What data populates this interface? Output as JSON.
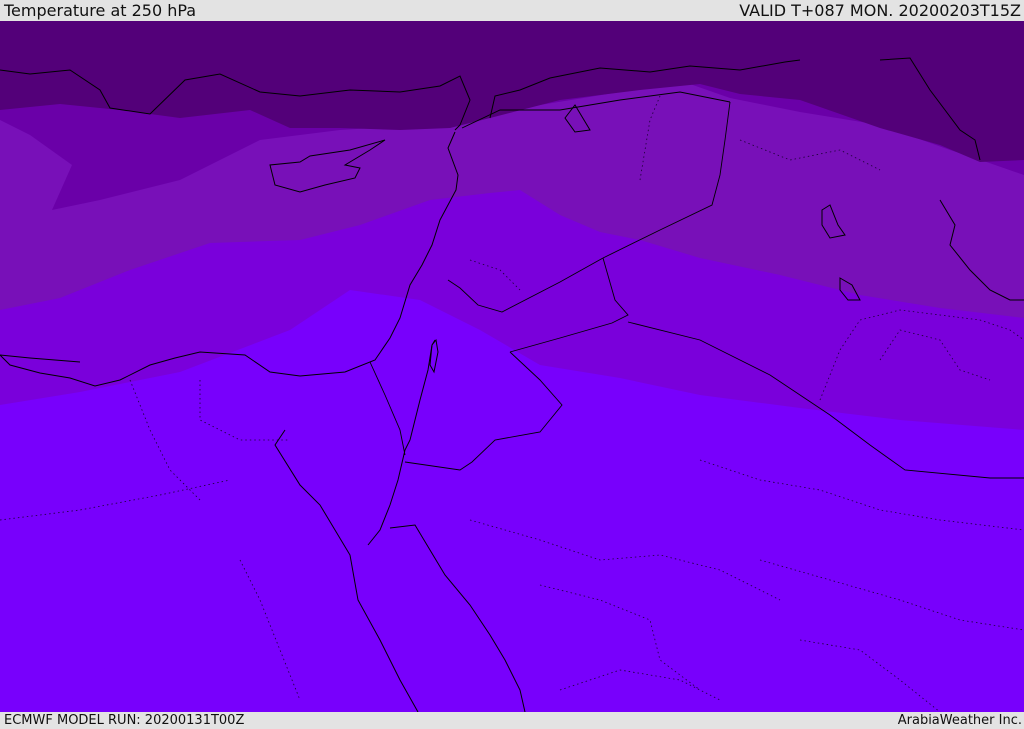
{
  "header": {
    "title": "Temperature at 250 hPa",
    "valid_time": "VALID T+087 MON. 20200203T15Z"
  },
  "footer": {
    "model_run": "ECMWF MODEL RUN: 20200131T00Z",
    "credit": "ArabiaWeather Inc."
  },
  "map": {
    "region": "Eastern Mediterranean, Levant, Egypt, Sinai, Red Sea, northern Arabian Peninsula",
    "colors": {
      "band_1_coldest": "#530079",
      "band_2": "#6a00a8",
      "band_3": "#7810b8",
      "band_4": "#7a00db",
      "band_5_warmest": "#7800fc",
      "borders": "#000000"
    }
  }
}
